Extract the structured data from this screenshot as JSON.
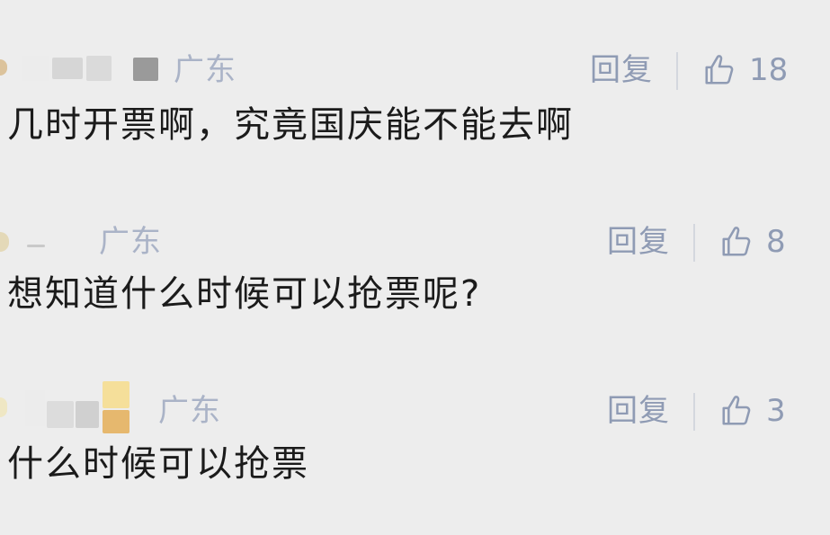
{
  "comments": [
    {
      "location": "广东",
      "reply_label": "回复",
      "likes": "18",
      "text": "几时开票啊，究竟国庆能不能去啊"
    },
    {
      "location": "广东",
      "reply_label": "回复",
      "likes": "8",
      "text": "想知道什么时候可以抢票呢?"
    },
    {
      "location": "广东",
      "reply_label": "回复",
      "likes": "3",
      "text": "什么时候可以抢票"
    }
  ],
  "colors": {
    "background": "#ededed",
    "meta_text": "#8f9bb4",
    "location_text": "#aab3c7",
    "body_text": "#1b1b1b",
    "divider": "#d4d7de"
  },
  "icons": {
    "like": "thumbs-up-icon",
    "avatar": "avatar"
  }
}
